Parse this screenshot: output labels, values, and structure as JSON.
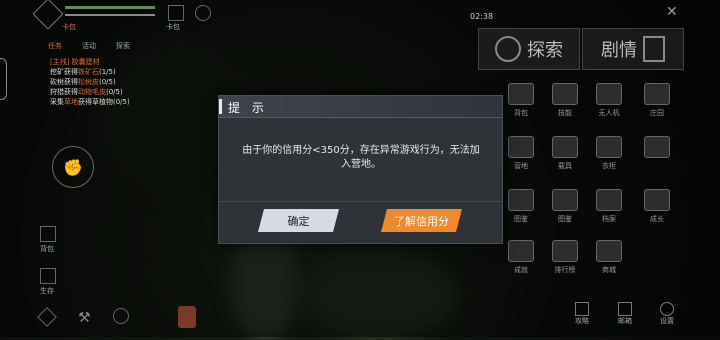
{
  "dialog": {
    "title": "提 示",
    "message": "由于你的信用分<350分，存在异常游戏行为，无法加入营地。",
    "confirm_label": "确定",
    "learn_label": "了解信用分"
  },
  "top": {
    "time": "02:38",
    "left_label": "卡包",
    "task_tabs": [
      "任务",
      "活动",
      "探索"
    ]
  },
  "quest": {
    "header": "[主线] 胶囊建材",
    "lines": [
      {
        "text": "挖矿获得",
        "hl": "铁矿石",
        "count": "(1/5)"
      },
      {
        "text": "砍树获得",
        "hl": "松树皮",
        "count": "(0/5)"
      },
      {
        "text": "狩猎获得",
        "hl": "动物毛皮",
        "count": "(0/5)"
      },
      {
        "text": "采集",
        "hl": "草地",
        "count": "获得草植物(0/5)"
      }
    ]
  },
  "right_header": {
    "explore_label": "探索",
    "story_label": "剧情"
  },
  "right_grid": [
    {
      "label": "背包"
    },
    {
      "label": "技能"
    },
    {
      "label": "无人机"
    },
    {
      "label": "庄园"
    },
    {
      "label": "营地"
    },
    {
      "label": "载具"
    },
    {
      "label": "衣柜"
    },
    {
      "label": ""
    },
    {
      "label": "图鉴"
    },
    {
      "label": "图鉴"
    },
    {
      "label": "档案"
    },
    {
      "label": "成长"
    },
    {
      "label": "成就"
    },
    {
      "label": "排行榜"
    },
    {
      "label": "商城"
    },
    {
      "label": ""
    }
  ],
  "bottom_right": [
    "攻略",
    "邮箱",
    "设置"
  ],
  "left_side": [
    "背包",
    "生存"
  ]
}
